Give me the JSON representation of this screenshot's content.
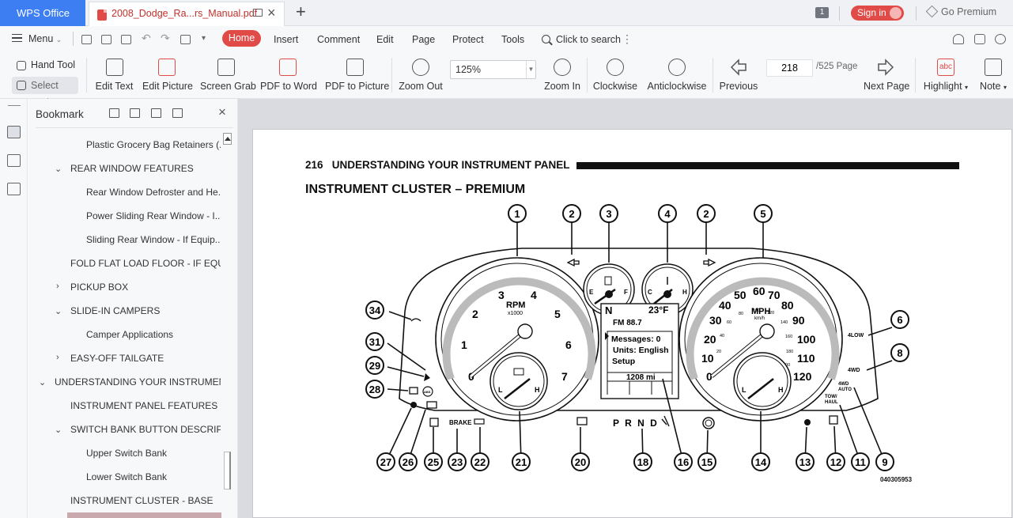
{
  "titlebar": {
    "app_name": "WPS Office",
    "doc_tab_name": "2008_Dodge_Ra...rs_Manual.pdf",
    "window_count": "1",
    "sign_in": "Sign in",
    "go_premium": "Go Premium"
  },
  "menubar": {
    "menu_label": "Menu",
    "tabs": [
      "Home",
      "Insert",
      "Comment",
      "Edit",
      "Page",
      "Protect",
      "Tools"
    ],
    "search": "Click to search"
  },
  "toolbar": {
    "hand_tool": "Hand Tool",
    "select_tool": "Select Tool",
    "edit_text": "Edit Text",
    "edit_picture": "Edit Picture",
    "screen_grab": "Screen Grab",
    "pdf_to_word": "PDF to Word",
    "pdf_to_picture": "PDF to Picture",
    "zoom_out": "Zoom Out",
    "zoom_value": "125%",
    "zoom_in": "Zoom In",
    "clockwise": "Clockwise",
    "anticlockwise": "Anticlockwise",
    "previous": "Previous",
    "current_page": "218",
    "page_total": "/525 Page",
    "next_page": "Next Page",
    "highlight": "Highlight",
    "highlight_icon_text": "abc",
    "note": "Note"
  },
  "bookmark": {
    "title": "Bookmark",
    "items": [
      "Plastic Grocery Bag Retainers (...",
      "REAR WINDOW FEATURES",
      "Rear Window Defroster and He...",
      "Power Sliding Rear Window - I...",
      "Sliding Rear Window - If Equip...",
      "FOLD FLAT LOAD FLOOR - IF EQUI...",
      "PICKUP BOX",
      "SLIDE-IN CAMPERS",
      "Camper Applications",
      "EASY-OFF TAILGATE",
      "UNDERSTANDING YOUR INSTRUMEN...",
      "INSTRUMENT PANEL FEATURES",
      "SWITCH BANK BUTTON DESCRIP...",
      "Upper Switch Bank",
      "Lower Switch Bank",
      "INSTRUMENT CLUSTER - BASE"
    ]
  },
  "document": {
    "page_number": "216",
    "section_header": "UNDERSTANDING YOUR INSTRUMENT PANEL",
    "title": "INSTRUMENT CLUSTER – PREMIUM",
    "figure_code": "040305953",
    "callouts": [
      "1",
      "2",
      "3",
      "4",
      "2",
      "5",
      "6",
      "8",
      "9",
      "11",
      "12",
      "13",
      "14",
      "15",
      "16",
      "18",
      "20",
      "21",
      "22",
      "23",
      "25",
      "26",
      "27",
      "28",
      "29",
      "31",
      "34"
    ],
    "tach": {
      "label": "RPM",
      "sub": "x1000",
      "ticks": [
        "0",
        "1",
        "2",
        "3",
        "4",
        "5",
        "6",
        "7"
      ]
    },
    "speedo": {
      "label": "MPH",
      "sub": "km/h",
      "ticks": [
        "0",
        "10",
        "20",
        "30",
        "40",
        "50",
        "60",
        "70",
        "80",
        "90",
        "100",
        "110",
        "120"
      ],
      "kmh_ticks": [
        "20",
        "40",
        "60",
        "80",
        "100",
        "120",
        "140",
        "160",
        "180",
        "200"
      ]
    },
    "gauges": {
      "fuel_e": "E",
      "fuel_f": "F",
      "temp_c": "C",
      "temp_h": "H",
      "low": "L",
      "high": "H"
    },
    "display": {
      "gear": "N",
      "temp": "23°F",
      "radio": "FM 88.7",
      "messages": "Messages:  0",
      "units": "Units:  English",
      "setup": "Setup",
      "odometer": "1208 mi"
    },
    "indicators": {
      "brake": "BRAKE",
      "prndl": "P R N D",
      "four_low": "4LOW",
      "four_wd": "4WD",
      "four_wd_auto_1": "4WD",
      "four_wd_auto_2": "AUTO",
      "tow_haul_1": "TOW/",
      "tow_haul_2": "HAUL",
      "abs": "ABS"
    }
  }
}
